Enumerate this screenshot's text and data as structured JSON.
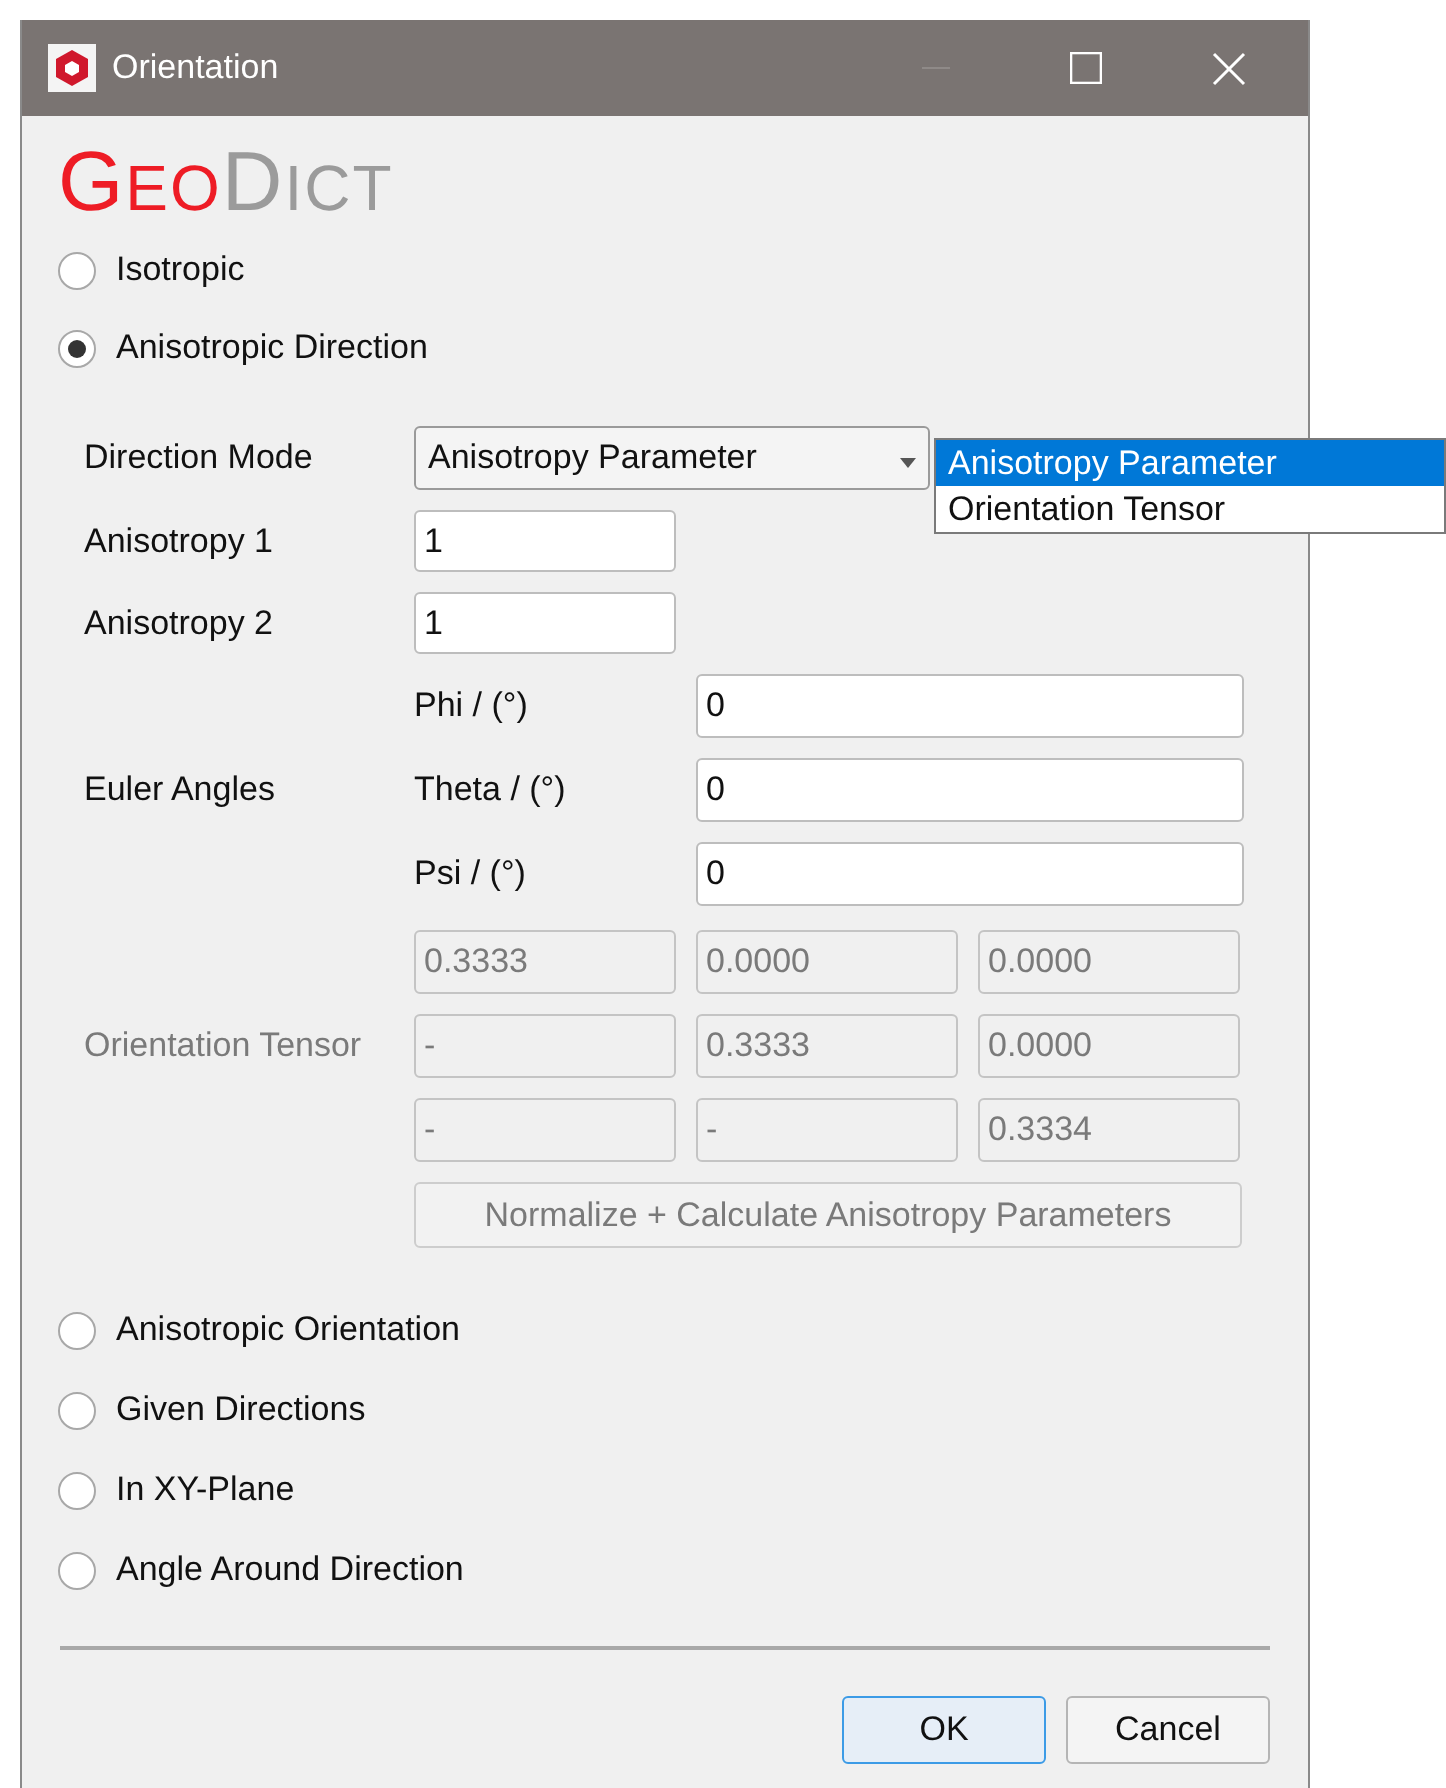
{
  "window": {
    "title": "Orientation"
  },
  "logo": [
    "GEO",
    "DICT"
  ],
  "options_top": [
    {
      "label": "Isotropic",
      "selected": false
    },
    {
      "label": "Anisotropic Direction",
      "selected": true
    }
  ],
  "direction_mode": {
    "label": "Direction Mode",
    "value": "Anisotropy Parameter",
    "expanded": true,
    "options": [
      {
        "label": "Anisotropy Parameter",
        "selected": true
      },
      {
        "label": "Orientation Tensor",
        "selected": false
      }
    ]
  },
  "anisotropy": [
    {
      "label": "Anisotropy 1",
      "value": "1"
    },
    {
      "label": "Anisotropy 2",
      "value": "1"
    }
  ],
  "euler_angles": {
    "label": "Euler Angles",
    "angles": [
      {
        "label": "Phi / (°)",
        "value": "0"
      },
      {
        "label": "Theta / (°)",
        "value": "0"
      },
      {
        "label": "Psi / (°)",
        "value": "0"
      }
    ]
  },
  "orientation_tensor": {
    "label": "Orientation Tensor",
    "disabled": true,
    "rows": [
      [
        "0.3333",
        "0.0000",
        "0.0000"
      ],
      [
        "-",
        "0.3333",
        "0.0000"
      ],
      [
        "-",
        "-",
        "0.3334"
      ]
    ],
    "button": "Normalize + Calculate Anisotropy Parameters"
  },
  "options_bottom": [
    {
      "label": "Anisotropic Orientation",
      "selected": false
    },
    {
      "label": "Given Directions",
      "selected": false
    },
    {
      "label": "In XY-Plane",
      "selected": false
    },
    {
      "label": "Angle Around Direction",
      "selected": false
    }
  ],
  "buttons": [
    {
      "label": "OK",
      "kind": "default"
    },
    {
      "label": "Cancel",
      "kind": "normal"
    }
  ]
}
